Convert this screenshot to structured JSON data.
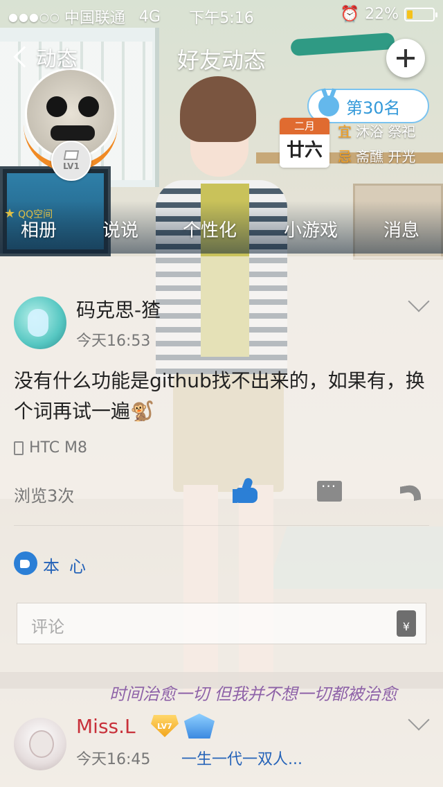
{
  "status_bar": {
    "carrier": "中国联通",
    "network": "4G",
    "time": "下午5:16",
    "battery": "22%",
    "battery_level": 0.22
  },
  "nav": {
    "back_label": "动态",
    "title": "好友动态"
  },
  "profile": {
    "level": "LV1",
    "space_label": "QQ空间"
  },
  "rank": {
    "label": "第30名"
  },
  "calendar": {
    "month": "二月",
    "day": "廿六",
    "yi_label": "宜",
    "yi_text": "沐浴 祭祀",
    "ji_label": "忌",
    "ji_text": "斋醮 开光"
  },
  "tabs": [
    {
      "label": "相册"
    },
    {
      "label": "说说"
    },
    {
      "label": "个性化"
    },
    {
      "label": "小游戏"
    },
    {
      "label": "消息"
    }
  ],
  "post": {
    "author": "码克思-猹",
    "time": "今天16:53",
    "text": "没有什么功能是github找不出来的，如果有，换个词再试一遍🐒",
    "device": "HTC M8",
    "views": "浏览3次",
    "liker": "本心"
  },
  "comment": {
    "placeholder": "评论",
    "gift_symbol": "¥"
  },
  "watermark": "时间治愈一切 但我并不想一切都被治愈",
  "post2": {
    "author": "Miss.L",
    "vip_label": "LV7",
    "time": "今天16:45",
    "preview": "一生一代一双人..."
  },
  "colors": {
    "accent_blue": "#2b7fd6",
    "rank_blue": "#3399d9",
    "calendar_orange": "#e06b30",
    "name_red": "#c8303a"
  },
  "icons": [
    "back-chevron-icon",
    "plus-icon",
    "medal-icon",
    "phone-icon",
    "like-icon",
    "comment-icon",
    "share-icon",
    "gift-icon",
    "expand-chevron-icon"
  ]
}
